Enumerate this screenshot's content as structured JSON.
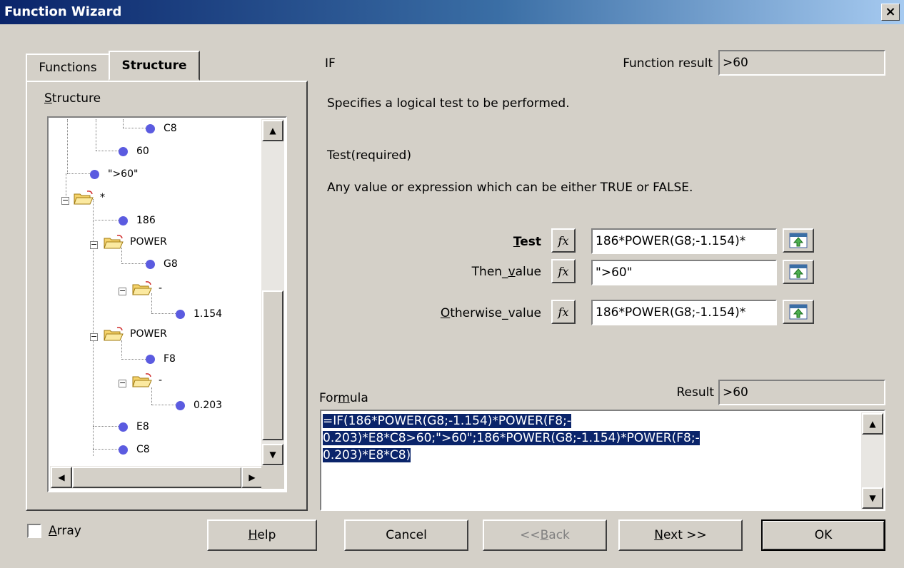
{
  "window": {
    "title": "Function Wizard"
  },
  "tabs": [
    {
      "label": "Functions"
    },
    {
      "label": "Structure"
    }
  ],
  "structure_panel": {
    "label": "Structure",
    "tree_items": [
      {
        "label": "C8",
        "kind": "leaf"
      },
      {
        "label": "60",
        "kind": "leaf"
      },
      {
        "label": "\">60\"",
        "kind": "leaf"
      },
      {
        "label": "*",
        "kind": "folder"
      },
      {
        "label": "186",
        "kind": "leaf"
      },
      {
        "label": "POWER",
        "kind": "folder"
      },
      {
        "label": "G8",
        "kind": "leaf"
      },
      {
        "label": "-",
        "kind": "folder"
      },
      {
        "label": "1.154",
        "kind": "leaf"
      },
      {
        "label": "POWER",
        "kind": "folder"
      },
      {
        "label": "F8",
        "kind": "leaf"
      },
      {
        "label": "-",
        "kind": "folder"
      },
      {
        "label": "0.203",
        "kind": "leaf"
      },
      {
        "label": "E8",
        "kind": "leaf"
      },
      {
        "label": "C8",
        "kind": "leaf"
      }
    ]
  },
  "function": {
    "name": "IF",
    "result_label": "Function result",
    "result_value": ">60",
    "description": "Specifies a logical test to be performed.",
    "param_title": "Test(required)",
    "param_description": "Any value or expression which can be either TRUE or FALSE."
  },
  "arguments": [
    {
      "label": "Test",
      "value": "186*POWER(G8;-1.154)*"
    },
    {
      "label": "Then_value",
      "value": "\">60\""
    },
    {
      "label": "Otherwise_value",
      "value": "186*POWER(G8;-1.154)*"
    }
  ],
  "formula": {
    "label": "Formula",
    "result_label": "Result",
    "result_value": ">60",
    "lines": [
      "=IF(186*POWER(G8;-1.154)*POWER(F8;-",
      "0.203)*E8*C8>60;\">60\";186*POWER(G8;-1.154)*POWER(F8;-",
      "0.203)*E8*C8)"
    ]
  },
  "footer": {
    "array_label": "Array",
    "array_checked": false,
    "buttons": {
      "help": "Help",
      "cancel": "Cancel",
      "back": "<< Back",
      "next": "Next >>",
      "ok": "OK"
    }
  },
  "icons": {
    "fx": "fx-icon",
    "shrink": "shrink-icon",
    "close": "close-icon"
  }
}
